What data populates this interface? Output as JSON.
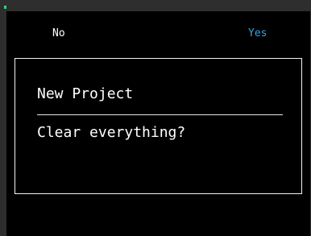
{
  "softkeys": {
    "left_label": "No",
    "right_label": "Yes"
  },
  "dialog": {
    "title": "New Project",
    "message": "Clear everything?"
  },
  "colors": {
    "background": "#000000",
    "text": "#ffffff",
    "accent": "#2aa6e8",
    "status_indicator": "#33d17a"
  }
}
